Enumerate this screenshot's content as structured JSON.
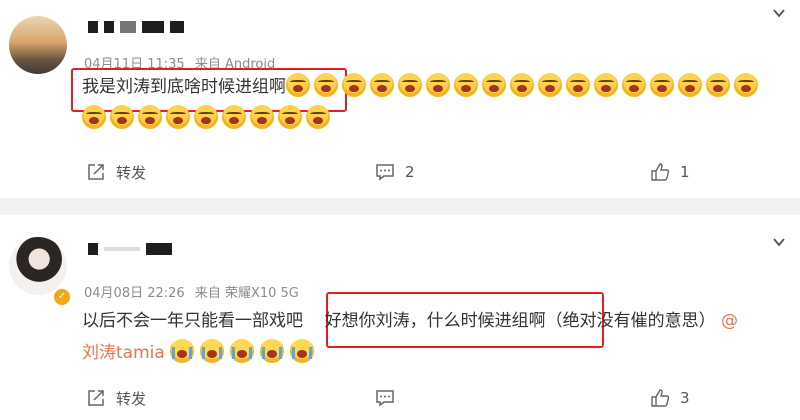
{
  "posts": [
    {
      "time": "04月11日 11:35",
      "source": "来自 Android",
      "text": "我是刘涛到底啥时候进组啊",
      "emoji_count": 26,
      "actions": {
        "forward_label": "转发",
        "comment_count": "2",
        "like_count": "1"
      }
    },
    {
      "time": "04月08日 22:26",
      "source": "来自 荣耀X10 5G",
      "text_before": "以后不会一年只能看一部戏吧",
      "text_highlight": "好想你刘涛，什么时候进组啊",
      "text_after": "（绝对没有催的意思）",
      "mention_at": "@",
      "mention_name": "刘涛tamia",
      "emoji_count": 5,
      "actions": {
        "forward_label": "转发",
        "comment_count": "",
        "like_count": "3"
      }
    }
  ],
  "icons": [
    "forward-icon",
    "comment-icon",
    "like-icon",
    "chevron-down-icon",
    "verified-badge-icon"
  ],
  "colors": {
    "mention": "#eb7350",
    "highlight_box": "#e41f1f",
    "divider": "#f2f2f5",
    "verified": "#f3a51c"
  }
}
